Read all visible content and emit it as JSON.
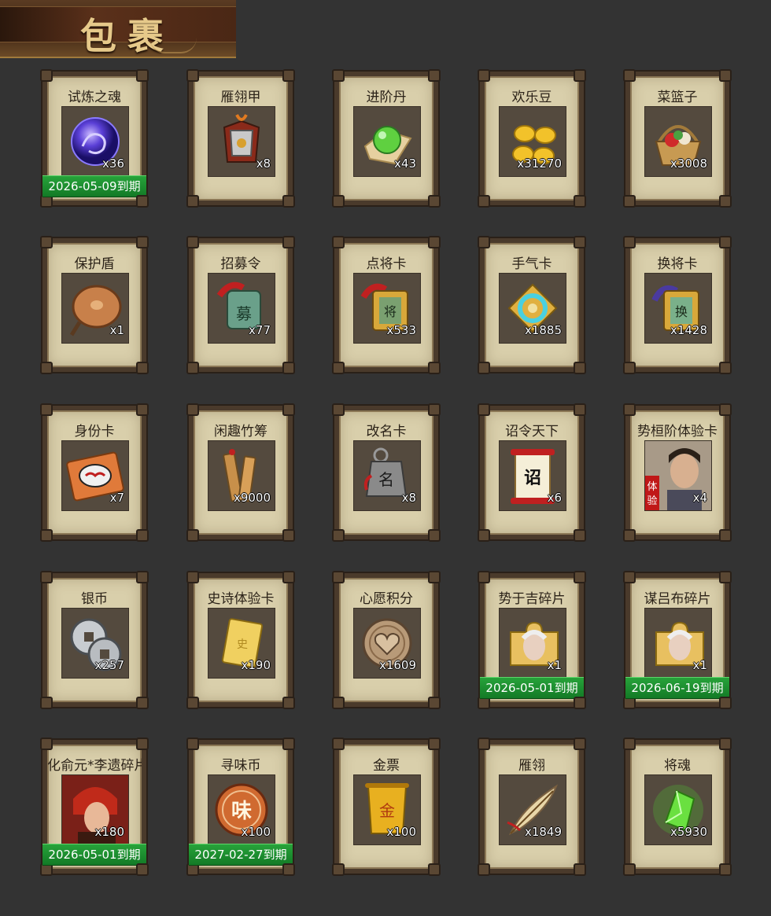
{
  "header": {
    "title": "包裹"
  },
  "items": [
    {
      "name": "试炼之魂",
      "count": "x36",
      "expiry": "2026-05-09到期",
      "icon": "purple-dragon-orb-icon"
    },
    {
      "name": "雁翎甲",
      "count": "x8",
      "expiry": "",
      "icon": "armor-icon"
    },
    {
      "name": "进阶丹",
      "count": "x43",
      "expiry": "",
      "icon": "green-pill-icon"
    },
    {
      "name": "欢乐豆",
      "count": "x31270",
      "expiry": "",
      "icon": "gold-beans-icon"
    },
    {
      "name": "菜篮子",
      "count": "x3008",
      "expiry": "",
      "icon": "basket-icon"
    },
    {
      "name": "保护盾",
      "count": "x1",
      "expiry": "",
      "icon": "shield-icon"
    },
    {
      "name": "招募令",
      "count": "x77",
      "expiry": "",
      "icon": "recruit-token-icon"
    },
    {
      "name": "点将卡",
      "count": "x533",
      "expiry": "",
      "icon": "general-token-icon"
    },
    {
      "name": "手气卡",
      "count": "x1885",
      "expiry": "",
      "icon": "luck-card-icon"
    },
    {
      "name": "换将卡",
      "count": "x1428",
      "expiry": "",
      "icon": "swap-token-icon"
    },
    {
      "name": "身份卡",
      "count": "x7",
      "expiry": "",
      "icon": "identity-card-icon"
    },
    {
      "name": "闲趣竹筹",
      "count": "x9000",
      "expiry": "",
      "icon": "bamboo-tally-icon"
    },
    {
      "name": "改名卡",
      "count": "x8",
      "expiry": "",
      "icon": "rename-tag-icon"
    },
    {
      "name": "诏令天下",
      "count": "x6",
      "expiry": "",
      "icon": "edict-scroll-icon"
    },
    {
      "name": "势桓阶体验卡",
      "count": "x4",
      "expiry": "",
      "icon": "general-portrait-icon"
    },
    {
      "name": "银币",
      "count": "x257",
      "expiry": "",
      "icon": "silver-coin-icon"
    },
    {
      "name": "史诗体验卡",
      "count": "x190",
      "expiry": "",
      "icon": "gold-card-icon"
    },
    {
      "name": "心愿积分",
      "count": "x1609",
      "expiry": "",
      "icon": "heart-coin-icon"
    },
    {
      "name": "势于吉碎片",
      "count": "x1",
      "expiry": "2026-05-01到期",
      "icon": "puzzle-fragment-icon"
    },
    {
      "name": "谋吕布碎片",
      "count": "x1",
      "expiry": "2026-06-19到期",
      "icon": "puzzle-fragment-icon"
    },
    {
      "name": "化俞元*李遗碎片",
      "count": "x180",
      "expiry": "2026-05-01到期",
      "icon": "hero-portrait-icon"
    },
    {
      "name": "寻味币",
      "count": "x100",
      "expiry": "2027-02-27到期",
      "icon": "flavor-coin-icon"
    },
    {
      "name": "金票",
      "count": "x100",
      "expiry": "",
      "icon": "gold-ticket-icon"
    },
    {
      "name": "雁翎",
      "count": "x1849",
      "expiry": "",
      "icon": "feather-icon"
    },
    {
      "name": "将魂",
      "count": "x5930",
      "expiry": "",
      "icon": "green-crystal-icon"
    }
  ]
}
